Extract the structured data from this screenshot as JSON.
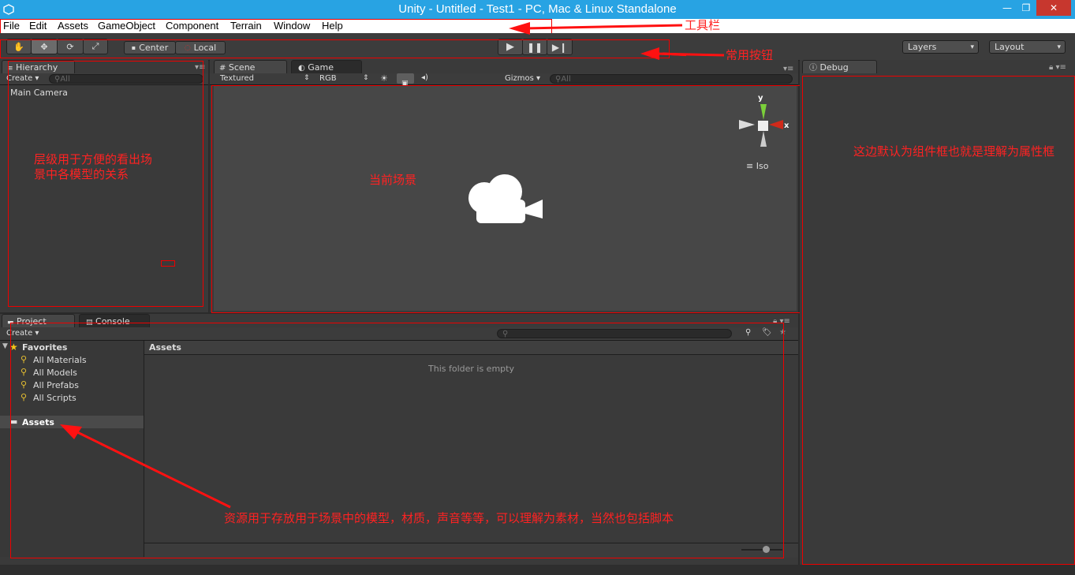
{
  "window": {
    "title": "Unity - Untitled - Test1 - PC, Mac & Linux Standalone",
    "minimize": "—",
    "restore": "❐",
    "close": "✕"
  },
  "menu": [
    "File",
    "Edit",
    "Assets",
    "GameObject",
    "Component",
    "Terrain",
    "Window",
    "Help"
  ],
  "toolbar": {
    "pivot_mode": "Center",
    "pivot_rotation": "Local",
    "layers": "Layers",
    "layout": "Layout"
  },
  "hierarchy": {
    "tab": "Hierarchy",
    "create": "Create",
    "search_placeholder": "All",
    "items": [
      "Main Camera"
    ]
  },
  "scene": {
    "tabs": [
      "Scene",
      "Game"
    ],
    "draw_mode": "Textured",
    "render_mode": "RGB",
    "gizmos": "Gizmos",
    "search_placeholder": "All",
    "gizmo_y": "y",
    "gizmo_x": "x",
    "iso_label": "Iso"
  },
  "inspector": {
    "tab": "Debug"
  },
  "project": {
    "tabs": [
      "Project",
      "Console"
    ],
    "create": "Create",
    "favorites_label": "Favorites",
    "favorites": [
      "All Materials",
      "All Models",
      "All Prefabs",
      "All Scripts"
    ],
    "assets_label": "Assets",
    "breadcrumb": "Assets",
    "empty_text": "This folder is empty"
  },
  "annotations": {
    "toolbar": "工具栏",
    "common_buttons": "常用按钮",
    "hierarchy_line1": "层级用于方便的看出场",
    "hierarchy_line2": "景中各模型的关系",
    "scene": "当前场景",
    "inspector": "这边默认为组件框也就是理解为属性框",
    "assets": "资源用于存放用于场景中的模型，材质，声音等等，可以理解为素材，当然也包括脚本"
  },
  "colors": {
    "title_bar": "#28a3e3",
    "annotation": "#ff2222",
    "panel": "#3a3a3a",
    "scene_bg": "#474747"
  }
}
